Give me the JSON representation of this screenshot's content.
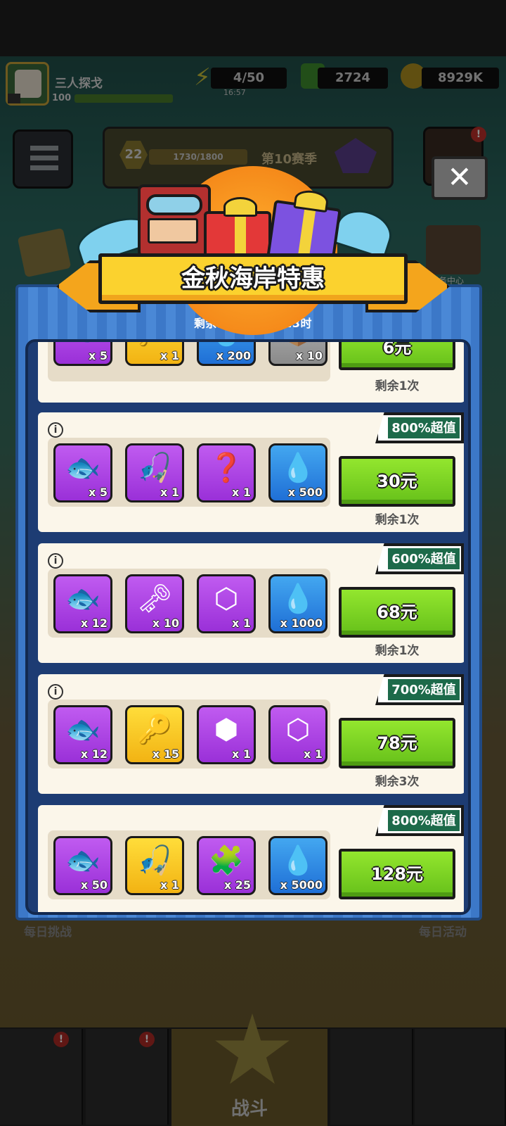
{
  "header": {
    "player_name": "三人探戈",
    "player_xp": "100",
    "energy": "4/50",
    "energy_timer": "16:57",
    "gems": "2724",
    "coins": "8929K"
  },
  "season": {
    "level": "22",
    "progress": "1730/1800",
    "label": "第10赛季"
  },
  "side": {
    "task_center": "任务中心",
    "daily_challenge": "每日挑战",
    "daily_event": "每日活动",
    "alert": "!"
  },
  "nav": {
    "battle": "战斗"
  },
  "popup": {
    "title": "金秋海岸特惠",
    "timer": "剩余时间：05天 23时",
    "close": "✕",
    "info_glyph": "i"
  },
  "offers": [
    {
      "price": "6元",
      "remaining": "剩余1次",
      "value": "",
      "items": [
        {
          "icon": "fishing-lure-icon",
          "qty": "x 5"
        },
        {
          "icon": "key-icon",
          "qty": "x 1"
        },
        {
          "icon": "oil-drop-icon",
          "qty": "x 200"
        },
        {
          "icon": "chest-icon",
          "qty": "x 10"
        }
      ]
    },
    {
      "price": "30元",
      "remaining": "剩余1次",
      "value": "800%超值",
      "items": [
        {
          "icon": "fishing-lure-icon",
          "qty": "x 5"
        },
        {
          "icon": "fishing-rod-icon",
          "qty": "x 1"
        },
        {
          "icon": "mystery-chest-icon",
          "qty": "x 1"
        },
        {
          "icon": "oil-drop-icon",
          "qty": "x 500"
        }
      ]
    },
    {
      "price": "68元",
      "remaining": "剩余1次",
      "value": "600%超值",
      "items": [
        {
          "icon": "fishing-lure-icon",
          "qty": "x 12"
        },
        {
          "icon": "gold-key-icon",
          "qty": "x 10"
        },
        {
          "icon": "hex-chest-icon",
          "qty": "x 1"
        },
        {
          "icon": "oil-drop-icon",
          "qty": "x 1000"
        }
      ]
    },
    {
      "price": "78元",
      "remaining": "剩余3次",
      "value": "700%超值",
      "items": [
        {
          "icon": "fishing-lure-icon",
          "qty": "x 12"
        },
        {
          "icon": "key-icon",
          "qty": "x 15"
        },
        {
          "icon": "open-chest-icon",
          "qty": "x 1"
        },
        {
          "icon": "hex-chest-icon",
          "qty": "x 1"
        }
      ]
    },
    {
      "price": "128元",
      "remaining": "",
      "value": "800%超值",
      "items": [
        {
          "icon": "fishing-lure-icon",
          "qty": "x 50"
        },
        {
          "icon": "fishing-rod-icon",
          "qty": "x 1"
        },
        {
          "icon": "character-shard-icon",
          "qty": "x 25"
        },
        {
          "icon": "oil-drop-icon",
          "qty": "x 5000"
        }
      ]
    }
  ]
}
